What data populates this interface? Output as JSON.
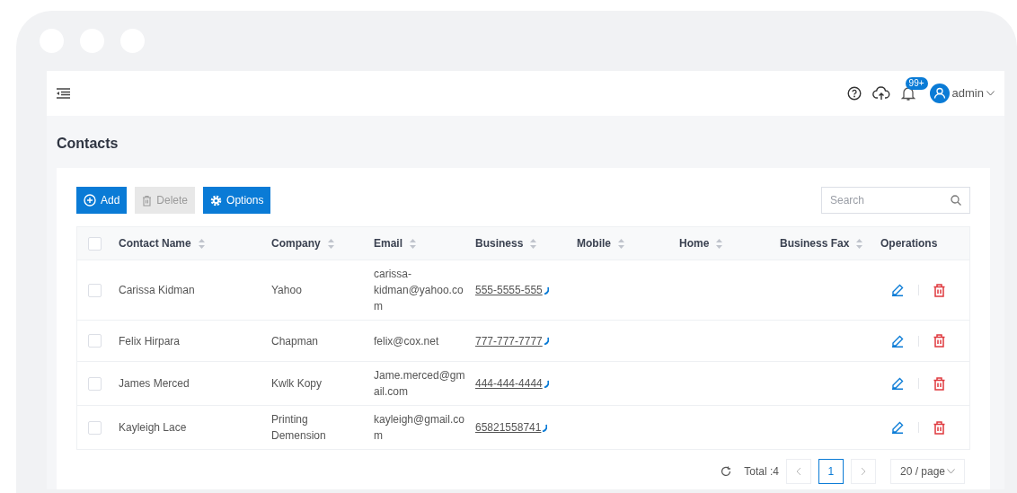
{
  "header": {
    "notification_badge": "99+",
    "user": "admin"
  },
  "page_title": "Contacts",
  "toolbar": [
    {
      "kind": "add",
      "label": "Add",
      "disabled": false
    },
    {
      "kind": "delete",
      "label": "Delete",
      "disabled": true
    },
    {
      "kind": "options",
      "label": "Options",
      "disabled": false
    }
  ],
  "search": {
    "placeholder": "Search"
  },
  "table": {
    "select_all": {
      "checked": false
    },
    "columns": [
      {
        "label": "Contact Name",
        "sortable": true
      },
      {
        "label": "Company",
        "sortable": true
      },
      {
        "label": "Email",
        "sortable": true
      },
      {
        "label": "Business",
        "sortable": true
      },
      {
        "label": "Mobile",
        "sortable": true
      },
      {
        "label": "Home",
        "sortable": true
      },
      {
        "label": "Business Fax",
        "sortable": true
      },
      {
        "label": "Operations",
        "sortable": false
      }
    ],
    "rows": [
      {
        "checked": false,
        "contact_name": "Carissa Kidman",
        "company": "Yahoo",
        "email": "carissa-kidman@yahoo.com",
        "business": "555-5555-555"
      },
      {
        "checked": false,
        "contact_name": "Felix Hirpara",
        "company": "Chapman",
        "email": "felix@cox.net",
        "business": "777-777-7777"
      },
      {
        "checked": false,
        "contact_name": "James Merced",
        "company": "Kwlk Kopy",
        "email": "Jame.merced@gmail.com",
        "business": "444-444-4444"
      },
      {
        "checked": false,
        "contact_name": "Kayleigh Lace",
        "company": "Printing Demension",
        "email": "kayleigh@gmail.com",
        "business": "65821558741"
      }
    ]
  },
  "pagination": {
    "total": "Total :4",
    "pages": [
      {
        "label": "1",
        "selected": true
      }
    ],
    "page_size": "20 / page"
  }
}
